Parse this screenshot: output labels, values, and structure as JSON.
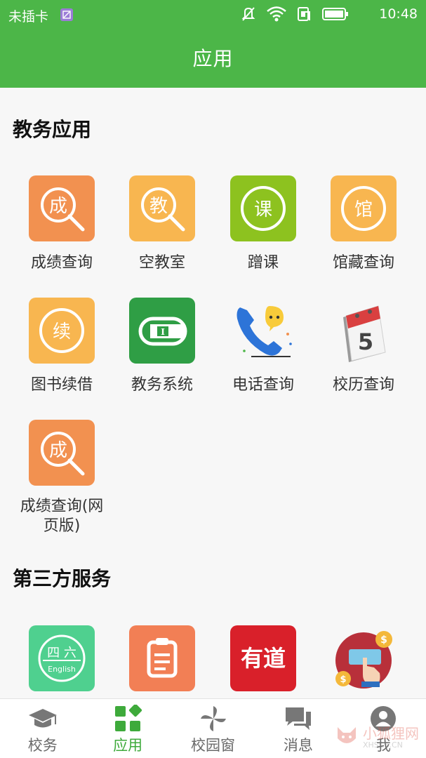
{
  "status_bar": {
    "carrier": "未插卡",
    "time": "10:48"
  },
  "header": {
    "title": "应用"
  },
  "sections": [
    {
      "title": "教务应用",
      "items": [
        {
          "label": "成绩查询",
          "glyph": "成",
          "icon": "grade-search-icon",
          "color": "#f29150"
        },
        {
          "label": "空教室",
          "glyph": "教",
          "icon": "classroom-search-icon",
          "color": "#f8b650"
        },
        {
          "label": "蹭课",
          "glyph": "课",
          "icon": "course-icon",
          "color": "#8dc21f"
        },
        {
          "label": "馆藏查询",
          "glyph": "馆",
          "icon": "library-icon",
          "color": "#f8b650"
        },
        {
          "label": "图书续借",
          "glyph": "续",
          "icon": "book-renew-icon",
          "color": "#f8b650"
        },
        {
          "label": "教务系统",
          "icon": "academic-system-icon",
          "color": "#2f9e45"
        },
        {
          "label": "电话查询",
          "icon": "phone-icon"
        },
        {
          "label": "校历查询",
          "glyph": "5",
          "icon": "calendar-icon"
        },
        {
          "label": "成绩查询(网页版)",
          "glyph": "成",
          "icon": "grade-search-web-icon",
          "color": "#f29150"
        }
      ]
    },
    {
      "title": "第三方服务",
      "items": [
        {
          "label": "",
          "icon": "cet-icon",
          "color": "#4fd08f",
          "text1": "四 六",
          "text2": "English"
        },
        {
          "label": "",
          "icon": "clipboard-icon",
          "color": "#f27f55"
        },
        {
          "label": "",
          "icon": "youdao-icon",
          "color": "#d9202a",
          "text1": "有道"
        },
        {
          "label": "",
          "icon": "finance-icon"
        }
      ]
    }
  ],
  "bottom_nav": [
    {
      "label": "校务",
      "icon": "graduation-cap-icon",
      "active": false
    },
    {
      "label": "应用",
      "icon": "apps-grid-icon",
      "active": true
    },
    {
      "label": "校园窗",
      "icon": "pinwheel-icon",
      "active": false
    },
    {
      "label": "消息",
      "icon": "chat-icon",
      "active": false
    },
    {
      "label": "我",
      "icon": "user-icon",
      "active": false
    }
  ],
  "watermark": {
    "text": "小狐狸网",
    "sub": "XHSCS.CN"
  },
  "colors": {
    "primary": "#4cb648",
    "active_tab": "#3eaa3b"
  }
}
